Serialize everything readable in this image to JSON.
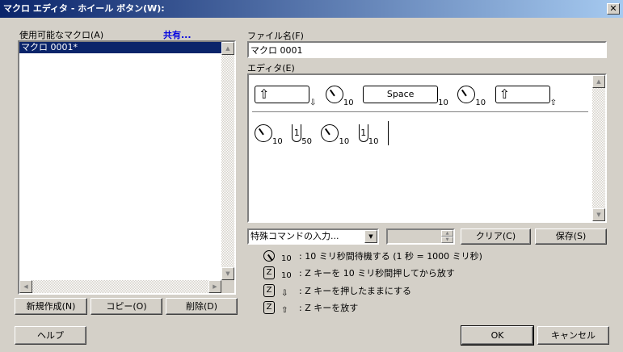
{
  "window": {
    "title": "マクロ エディタ - ホイール ボタン(W):",
    "close": "✕"
  },
  "left": {
    "label": "使用可能なマクロ(A)",
    "share_link": "共有...",
    "macros": [
      "マクロ 0001*"
    ],
    "buttons": {
      "new": "新規作成(N)",
      "copy": "コピー(O)",
      "delete": "削除(D)"
    }
  },
  "right": {
    "filename_label": "ファイル名(F)",
    "filename_value": "マクロ 0001",
    "editor_label": "エディタ(E)",
    "row1": [
      {
        "type": "key",
        "label": "⇧",
        "sub": "⇩"
      },
      {
        "type": "wait",
        "sub": "10"
      },
      {
        "type": "key",
        "label": "Space",
        "sub": "10"
      },
      {
        "type": "wait",
        "sub": "10"
      },
      {
        "type": "key",
        "label": "⇧",
        "sub": "⇧"
      }
    ],
    "row2": [
      {
        "type": "wait",
        "sub": "10"
      },
      {
        "type": "mouse",
        "label": "1",
        "sub": "50"
      },
      {
        "type": "wait",
        "sub": "10"
      },
      {
        "type": "mouse",
        "label": "1",
        "sub": "10"
      }
    ],
    "special_command": "特殊コマンドの入力...",
    "clear": "クリア(C)",
    "save": "保存(S)"
  },
  "legend": [
    {
      "icon": "clock",
      "sub": "10",
      "text": ": 10 ミリ秒間待機する (1 秒 = 1000 ミリ秒)"
    },
    {
      "icon": "Z",
      "sub": "10",
      "text": ": Z キーを 10 ミリ秒間押してから放す"
    },
    {
      "icon": "Z",
      "sub": "⇩",
      "text": ": Z キーを押したままにする"
    },
    {
      "icon": "Z",
      "sub": "⇧",
      "text": ": Z キーを放す"
    }
  ],
  "footer": {
    "help": "ヘルプ",
    "ok": "OK",
    "cancel": "キャンセル"
  }
}
